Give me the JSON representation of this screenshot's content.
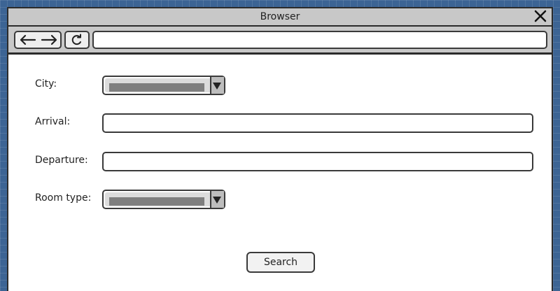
{
  "window": {
    "title": "Browser"
  },
  "toolbar": {
    "url": ""
  },
  "form": {
    "city_label": "City:",
    "arrival_label": "Arrival:",
    "departure_label": "Departure:",
    "room_type_label": "Room type:",
    "arrival_value": "",
    "departure_value": "",
    "search_label": "Search"
  },
  "icons": {
    "back": "arrow-left-icon",
    "forward": "arrow-right-icon",
    "refresh": "refresh-icon",
    "close": "close-icon",
    "dropdown": "triangle-down-icon"
  },
  "colors": {
    "desktop_background": "#3c6494",
    "titlebar": "#c8c8c8",
    "border": "#2b2b2b"
  }
}
